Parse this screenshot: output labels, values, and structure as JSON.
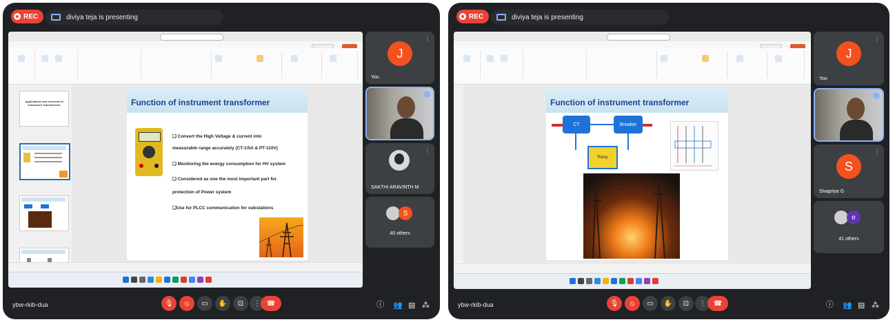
{
  "left": {
    "rec_label": "REC",
    "presenter_text": "diviya teja is presenting",
    "meeting_code": "ybw-rkib-dua",
    "slide": {
      "title": "Function of instrument transformer",
      "bullets": [
        "❑ Convert the High Voltage & current into",
        "measurable range  accurately (CT-1/5A & PT-110V)",
        "❑ Monitoring the energy consumption for HV system",
        "❑ Considered as one the most important part for",
        "protection of Power system",
        "❑Use for PLCC communication for substations"
      ],
      "thumb1_title": "Applications and overview of Instrument Transformers"
    },
    "tiles": {
      "you_initial": "J",
      "you_label": "You",
      "sakthi_label": "SAKTHI ARAVINTH M",
      "others_label": "40 others",
      "others_initial": "S"
    }
  },
  "right": {
    "rec_label": "REC",
    "presenter_text": "diviya teja is presenting",
    "meeting_code": "ybw-rkib-dua",
    "slide": {
      "title": "Function of instrument transformer",
      "ct_label": "CT",
      "breaker_label": "Breaker",
      "relay_label": "Relay"
    },
    "tiles": {
      "you_initial": "J",
      "you_label": "You",
      "sivapriya_initial": "S",
      "sivapriya_label": "Sivapriya G",
      "others_label": "41 others",
      "others_initial": "e"
    }
  },
  "colors": {
    "meet_bg": "#202124",
    "tile_bg": "#3c4043",
    "red": "#ea4335",
    "avatar_orange": "#f4511e",
    "avatar_purple": "#5e35b1",
    "slide_title": "#1f3f8f"
  }
}
